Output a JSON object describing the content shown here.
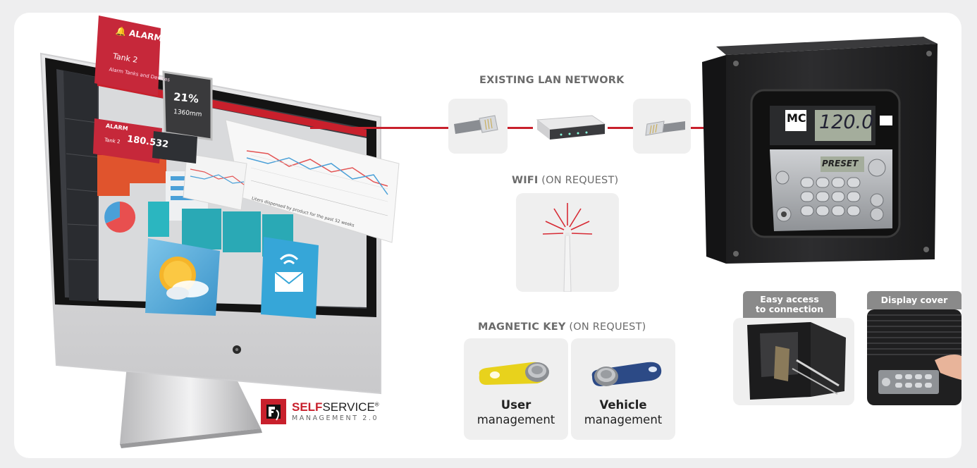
{
  "network": {
    "lan_heading_bold": "EXISTING LAN  NETWORK",
    "wifi_heading_bold": "WIFI",
    "wifi_heading_rest": " (ON REQUEST)",
    "magnetic_heading_bold": "MAGNETIC KEY",
    "magnetic_heading_rest": " (ON REQUEST)"
  },
  "keys": {
    "user_bold": "User",
    "user_rest": "management",
    "vehicle_bold": "Vehicle",
    "vehicle_rest": "management"
  },
  "device": {
    "brand": "MC",
    "display_value": "120.0",
    "button_label": "PRESET"
  },
  "features": {
    "easy_access_line1": "Easy access",
    "easy_access_line2": "to connection",
    "display_cover": "Display cover"
  },
  "logo": {
    "self": "SELF",
    "service": "SERVICE",
    "reg": "®",
    "subtitle": "MANAGEMENT 2.0"
  },
  "screen": {
    "alarm_label": "ALARM",
    "tank_label": "Tank 2",
    "alarm_sub": "Alarm Tanks and Devices",
    "percent": "21%",
    "mm": "1360mm",
    "alarm2_label": "ALARM",
    "tank2_label": "Tank 2",
    "value": "180.532",
    "chart_caption": "Liters dispensed by product for the past 52 weeks"
  },
  "colors": {
    "accent": "#c8202c",
    "badge": "#8a8a8a",
    "key_yellow": "#e8d21c",
    "key_blue": "#2c4a86"
  }
}
